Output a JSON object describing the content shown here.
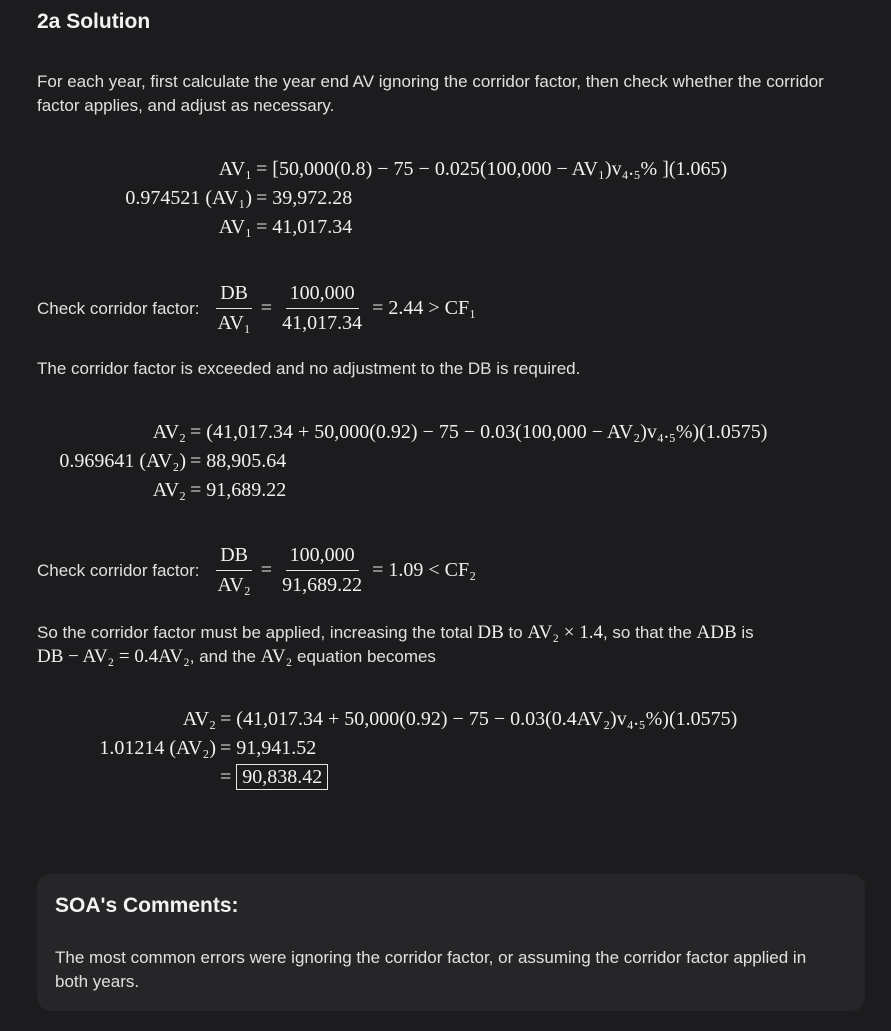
{
  "title": "2a Solution",
  "intro": "For each year, first calculate the year end AV ignoring the corridor factor, then check whether the corridor factor applies, and adjust as necessary.",
  "year1": {
    "eq1_lhs": "AV₁",
    "eq1_rhs": "= [50,000(0.8) − 75 − 0.025(100,000 − AV₁)v₄.₅% ](1.065)",
    "eq2_lhs": "0.974521 (AV₁)",
    "eq2_rhs": "= 39,972.28",
    "eq3_lhs": "AV₁",
    "eq3_rhs": "= 41,017.34",
    "check_label": "Check corridor factor:",
    "frac1_num": "DB",
    "frac1_den": "AV₁",
    "frac2_num": "100,000",
    "frac2_den": "41,017.34",
    "check_result": "= 2.44 > CF₁",
    "conclusion": "The corridor factor is exceeded and no adjustment to the DB is required."
  },
  "year2": {
    "eq1_lhs": "AV₂",
    "eq1_rhs": "= (41,017.34 + 50,000(0.92) − 75 − 0.03(100,000 − AV₂)v₄.₅%)(1.0575)",
    "eq2_lhs": "0.969641 (AV₂)",
    "eq2_rhs": "= 88,905.64",
    "eq3_lhs": "AV₂",
    "eq3_rhs": "= 91,689.22",
    "check_label": "Check corridor factor:",
    "frac1_num": "DB",
    "frac1_den": "AV₂",
    "frac2_num": "100,000",
    "frac2_den": "91,689.22",
    "check_result": "= 1.09 < CF₂",
    "para_a": "So the corridor factor must be applied, increasing the total ",
    "para_db": "DB",
    "para_b": " to ",
    "para_av": "AV₂ × 1.4",
    "para_c": ", so that the ",
    "para_adb": "ADB",
    "para_d": " is ",
    "para_expr1": "DB − AV₂ = 0.4AV₂",
    "para_e": ", and the ",
    "para_av2": "AV₂",
    "para_f": " equation becomes",
    "adj_eq1_lhs": "AV₂",
    "adj_eq1_rhs": "= (41,017.34 + 50,000(0.92) − 75 − 0.03(0.4AV₂)v₄.₅%)(1.0575)",
    "adj_eq2_lhs": "1.01214 (AV₂)",
    "adj_eq2_rhs": "= 91,941.52",
    "adj_eq3_eq": "=",
    "adj_eq3_box": "90,838.42"
  },
  "soa": {
    "heading": "SOA's Comments:",
    "body": "The most common errors were ignoring the corridor factor, or assuming the corridor factor applied in both years."
  }
}
